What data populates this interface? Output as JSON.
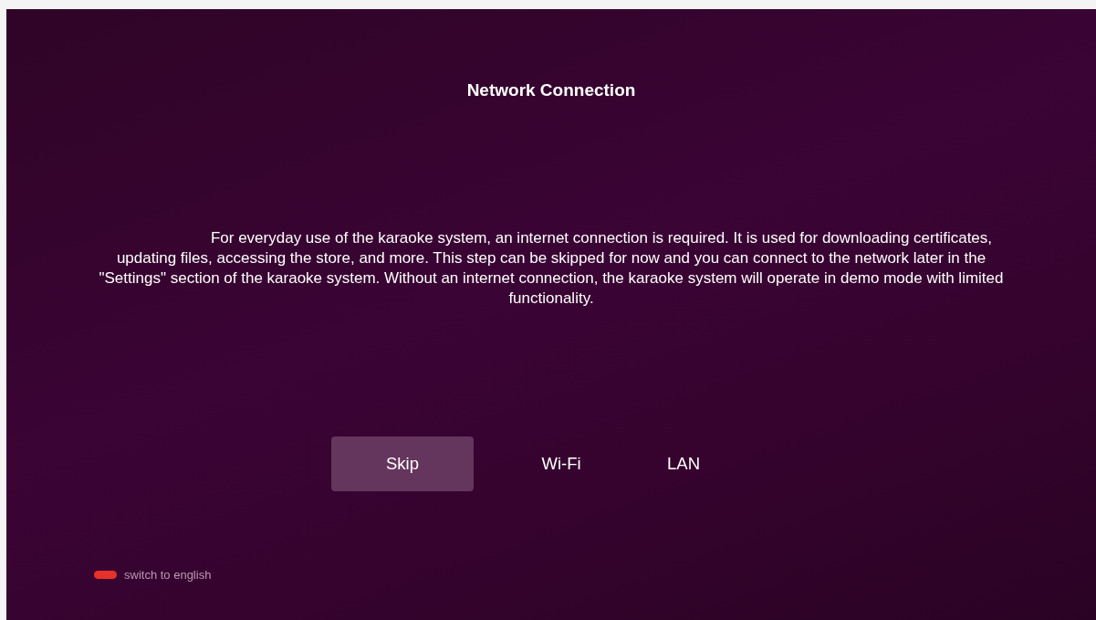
{
  "title": "Network Connection",
  "description": "For everyday use of the karaoke system, an internet connection is required. It is used for downloading certificates, updating files, accessing the store, and more. This step can be skipped for now and you can connect to the network later in the \"Settings\" section of the karaoke system. Without an internet connection, the karaoke system will operate in demo mode with limited functionality.",
  "buttons": [
    {
      "label": "Skip",
      "selected": true
    },
    {
      "label": "Wi-Fi",
      "selected": false
    },
    {
      "label": "LAN",
      "selected": false
    }
  ],
  "language_switch": {
    "label": "switch to english"
  }
}
